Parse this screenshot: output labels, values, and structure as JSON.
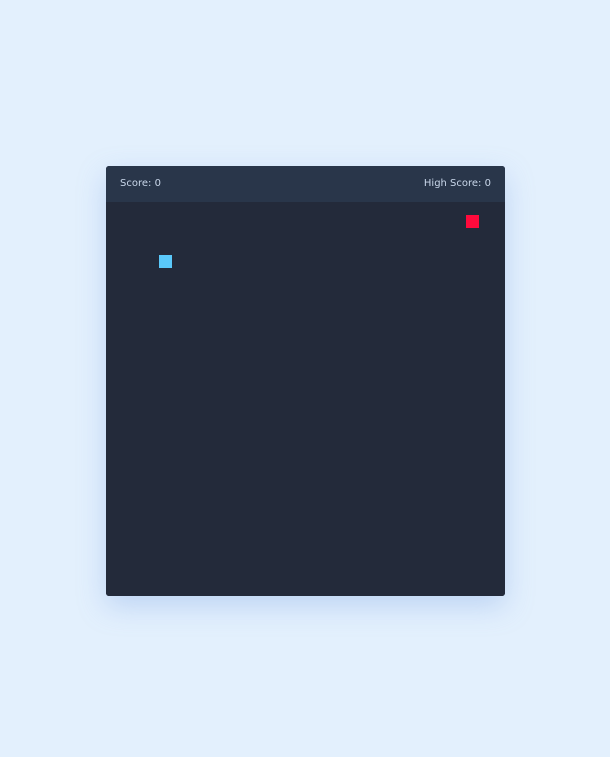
{
  "score": {
    "label": "Score:",
    "value": "0"
  },
  "high_score": {
    "label": "High Score:",
    "value": "0"
  },
  "colors": {
    "snake": "#5ac8fa",
    "food": "#ff0a3c",
    "board": "#232a3a",
    "score_bar": "#29364a"
  }
}
